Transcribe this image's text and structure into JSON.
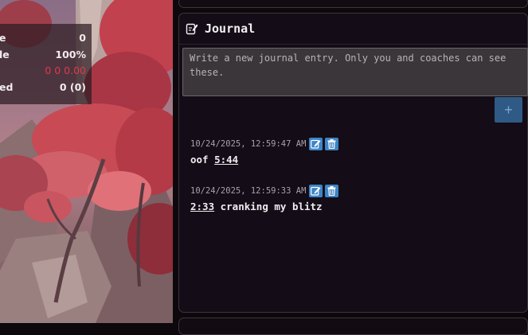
{
  "stats": [
    {
      "label": "e",
      "value": "0",
      "color": "#f2eaec"
    },
    {
      "label": "le",
      "value": "100%",
      "color": "#f2eaec"
    },
    {
      "label": "",
      "value": "0 0 0.00",
      "color": "#e0384a"
    },
    {
      "label": "ed",
      "value": "0 (0)",
      "color": "#f2eaec"
    }
  ],
  "journal": {
    "title": "Journal",
    "icon": "edit-note-icon",
    "placeholder": "Write a new journal entry. Only you and coaches can see these.",
    "add_label": "+",
    "entries": [
      {
        "timestamp": "10/24/2025, 12:59:47 AM",
        "text_before": "oof ",
        "link": "5:44",
        "text_after": ""
      },
      {
        "timestamp": "10/24/2025, 12:59:33 AM",
        "text_before": "",
        "link": "2:33",
        "text_after": " cranking my blitz"
      }
    ]
  },
  "colors": {
    "accent": "#3d84c6",
    "add_button": "#2f5a86",
    "panel_bg": "#140c16",
    "error_red": "#e0384a"
  }
}
